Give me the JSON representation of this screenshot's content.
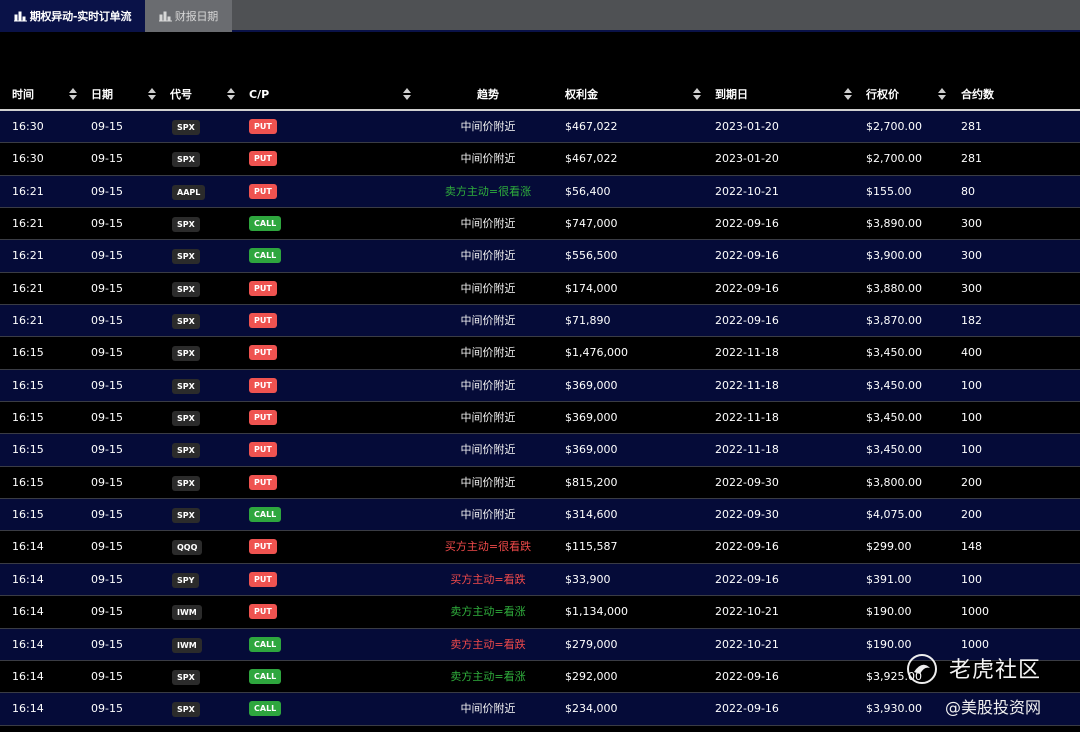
{
  "tabs": [
    {
      "label": "期权异动-实时订单流",
      "active": true
    },
    {
      "label": "财报日期",
      "active": false
    }
  ],
  "columns": [
    "时间",
    "日期",
    "代号",
    "C/P",
    "趋势",
    "权利金",
    "到期日",
    "行权价",
    "合约数"
  ],
  "rows": [
    {
      "time": "16:30",
      "date": "09-15",
      "symbol": "SPX",
      "cp": "PUT",
      "trend": "中间价附近",
      "premium": "$467,022",
      "expiry": "2023-01-20",
      "strike": "$2,700.00",
      "contracts": "281"
    },
    {
      "time": "16:30",
      "date": "09-15",
      "symbol": "SPX",
      "cp": "PUT",
      "trend": "中间价附近",
      "premium": "$467,022",
      "expiry": "2023-01-20",
      "strike": "$2,700.00",
      "contracts": "281"
    },
    {
      "time": "16:21",
      "date": "09-15",
      "symbol": "AAPL",
      "cp": "PUT",
      "trend": "卖方主动=很看涨",
      "premium": "$56,400",
      "expiry": "2022-10-21",
      "strike": "$155.00",
      "contracts": "80"
    },
    {
      "time": "16:21",
      "date": "09-15",
      "symbol": "SPX",
      "cp": "CALL",
      "trend": "中间价附近",
      "premium": "$747,000",
      "expiry": "2022-09-16",
      "strike": "$3,890.00",
      "contracts": "300"
    },
    {
      "time": "16:21",
      "date": "09-15",
      "symbol": "SPX",
      "cp": "CALL",
      "trend": "中间价附近",
      "premium": "$556,500",
      "expiry": "2022-09-16",
      "strike": "$3,900.00",
      "contracts": "300"
    },
    {
      "time": "16:21",
      "date": "09-15",
      "symbol": "SPX",
      "cp": "PUT",
      "trend": "中间价附近",
      "premium": "$174,000",
      "expiry": "2022-09-16",
      "strike": "$3,880.00",
      "contracts": "300"
    },
    {
      "time": "16:21",
      "date": "09-15",
      "symbol": "SPX",
      "cp": "PUT",
      "trend": "中间价附近",
      "premium": "$71,890",
      "expiry": "2022-09-16",
      "strike": "$3,870.00",
      "contracts": "182"
    },
    {
      "time": "16:15",
      "date": "09-15",
      "symbol": "SPX",
      "cp": "PUT",
      "trend": "中间价附近",
      "premium": "$1,476,000",
      "expiry": "2022-11-18",
      "strike": "$3,450.00",
      "contracts": "400"
    },
    {
      "time": "16:15",
      "date": "09-15",
      "symbol": "SPX",
      "cp": "PUT",
      "trend": "中间价附近",
      "premium": "$369,000",
      "expiry": "2022-11-18",
      "strike": "$3,450.00",
      "contracts": "100"
    },
    {
      "time": "16:15",
      "date": "09-15",
      "symbol": "SPX",
      "cp": "PUT",
      "trend": "中间价附近",
      "premium": "$369,000",
      "expiry": "2022-11-18",
      "strike": "$3,450.00",
      "contracts": "100"
    },
    {
      "time": "16:15",
      "date": "09-15",
      "symbol": "SPX",
      "cp": "PUT",
      "trend": "中间价附近",
      "premium": "$369,000",
      "expiry": "2022-11-18",
      "strike": "$3,450.00",
      "contracts": "100"
    },
    {
      "time": "16:15",
      "date": "09-15",
      "symbol": "SPX",
      "cp": "PUT",
      "trend": "中间价附近",
      "premium": "$815,200",
      "expiry": "2022-09-30",
      "strike": "$3,800.00",
      "contracts": "200"
    },
    {
      "time": "16:15",
      "date": "09-15",
      "symbol": "SPX",
      "cp": "CALL",
      "trend": "中间价附近",
      "premium": "$314,600",
      "expiry": "2022-09-30",
      "strike": "$4,075.00",
      "contracts": "200"
    },
    {
      "time": "16:14",
      "date": "09-15",
      "symbol": "QQQ",
      "cp": "PUT",
      "trend": "买方主动=很看跌",
      "premium": "$115,587",
      "expiry": "2022-09-16",
      "strike": "$299.00",
      "contracts": "148"
    },
    {
      "time": "16:14",
      "date": "09-15",
      "symbol": "SPY",
      "cp": "PUT",
      "trend": "买方主动=看跌",
      "premium": "$33,900",
      "expiry": "2022-09-16",
      "strike": "$391.00",
      "contracts": "100"
    },
    {
      "time": "16:14",
      "date": "09-15",
      "symbol": "IWM",
      "cp": "PUT",
      "trend": "卖方主动=看涨",
      "premium": "$1,134,000",
      "expiry": "2022-10-21",
      "strike": "$190.00",
      "contracts": "1000"
    },
    {
      "time": "16:14",
      "date": "09-15",
      "symbol": "IWM",
      "cp": "CALL",
      "trend": "卖方主动=看跌",
      "premium": "$279,000",
      "expiry": "2022-10-21",
      "strike": "$190.00",
      "contracts": "1000"
    },
    {
      "time": "16:14",
      "date": "09-15",
      "symbol": "SPX",
      "cp": "CALL",
      "trend": "卖方主动=看涨",
      "premium": "$292,000",
      "expiry": "2022-09-16",
      "strike": "$3,925.00",
      "contracts": ""
    },
    {
      "time": "16:14",
      "date": "09-15",
      "symbol": "SPX",
      "cp": "CALL",
      "trend": "中间价附近",
      "premium": "$234,000",
      "expiry": "2022-09-16",
      "strike": "$3,930.00",
      "contracts": ""
    }
  ],
  "trend_colors": {
    "neutral": "#f2f2f2",
    "bullish": "#2fae3c",
    "bearish": "#f04a4a"
  },
  "cp_colors": {
    "PUT": "#ef5350",
    "CALL": "#2ea63e"
  },
  "watermark": {
    "title": "老虎社区",
    "subtitle": "@美股投资网"
  }
}
